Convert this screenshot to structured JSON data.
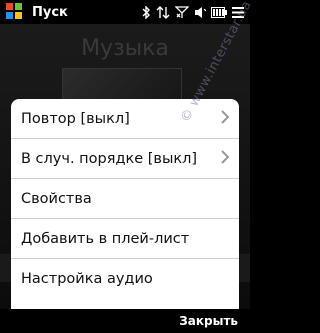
{
  "statusbar": {
    "title": "Пуск"
  },
  "background": {
    "title": "Музыка"
  },
  "menu": {
    "items": [
      {
        "label": "Повтор [выкл]",
        "has_submenu": true
      },
      {
        "label": "В случ. порядке [выкл]",
        "has_submenu": true
      },
      {
        "label": "Свойства",
        "has_submenu": false
      },
      {
        "label": "Добавить в плей-лист",
        "has_submenu": false
      },
      {
        "label": "Настройка аудио",
        "has_submenu": false
      }
    ]
  },
  "watermark": "© www.interstar.ua",
  "softkeys": {
    "right_label": "Закрыть"
  }
}
